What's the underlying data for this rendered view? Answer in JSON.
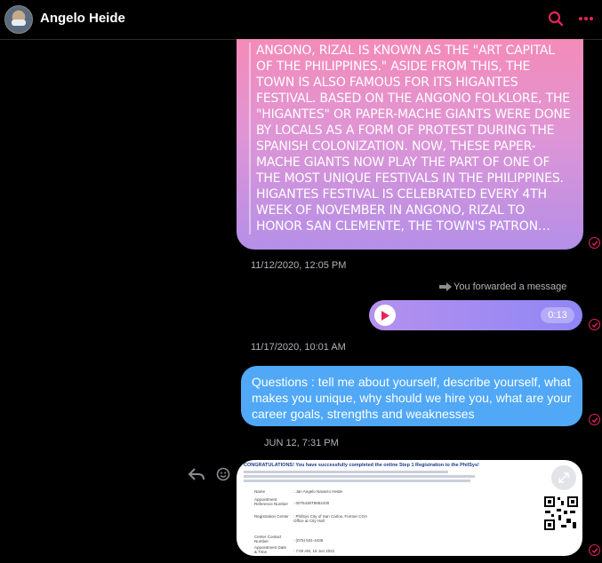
{
  "header": {
    "title": "Angelo Heide"
  },
  "icons": {
    "search": "search-icon",
    "more": "more-dots-icon",
    "seen": "check-circle-icon",
    "forward": "forward-arrow-icon",
    "play": "play-icon",
    "reply": "reply-icon",
    "react": "smiley-icon",
    "expand": "expand-icon"
  },
  "colors": {
    "accent": "#e8225e",
    "gradient_top": "#f48bb8",
    "gradient_bottom": "#b48fe8",
    "blue_bubble": "#50a8f7"
  },
  "messages": {
    "long_text": "Angono, Rizal is known as the \"Art Capital of the Philippines.\" Aside from this, the town is also famous for its Higantes Festival. Based on the Angono folklore, the \"Higantes\" or paper-mache giants were done by locals as a form of protest during the Spanish colonization. Now, these paper-mache giants now play the part of one of the most unique festivals in the Philippines. Higantes Festival is celebrated every 4th week of November in Angono, Rizal to honor San Clemente, the town's patron…",
    "ts1": "11/12/2020, 12:05 PM",
    "forward_label": "You forwarded a message",
    "audio_duration": "0:13",
    "ts2": "11/17/2020, 10:01 AM",
    "questions": "Questions : tell me about yourself, describe yourself, what makes you unique, why should we hire you, what are your career goals, strengths and weaknesses",
    "ts3": "JUN 12, 7:31 PM"
  },
  "attachment": {
    "title": "CONGRATULATIONS! You have successfully completed the online Step 1 Registration to the PhilSys!",
    "rows": [
      {
        "label": "Name",
        "value": ": Jan Angelo Navarro Heide"
      },
      {
        "label": "Appointment Reference Number",
        "value": ": 0075436T8852430"
      },
      {
        "label": "Registration Center",
        "value": ": PhilSys City of San Carlos, Former COA Office at City Hall"
      },
      {
        "label": "Center Contact Number",
        "value": ": (075) 531-4438"
      },
      {
        "label": "Appointment Date & Time",
        "value": ": 7:00 AM, 15 Jun 2021"
      }
    ]
  }
}
